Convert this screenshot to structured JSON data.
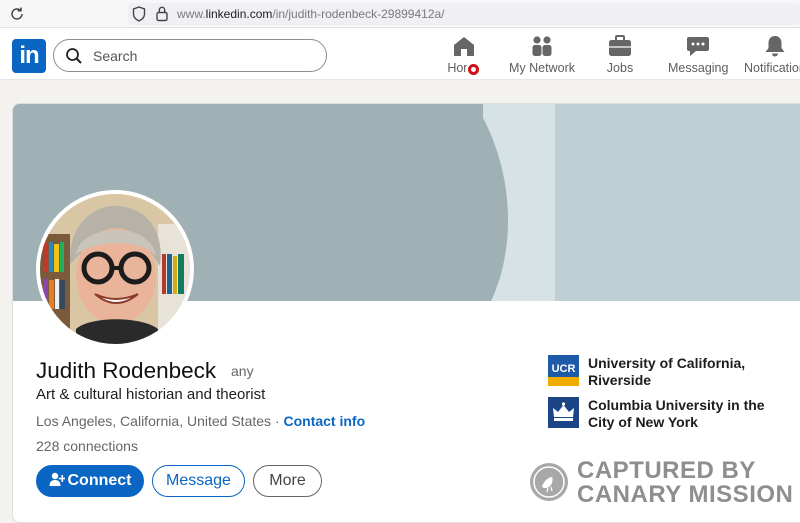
{
  "browser": {
    "url_prefix": "www.",
    "url_host": "linkedin.com",
    "url_path": "/in/judith-rodenbeck-29899412a/"
  },
  "nav": {
    "logo_text": "in",
    "search_placeholder": "Search",
    "items": [
      {
        "label": "Home",
        "icon": "home-icon"
      },
      {
        "label": "My Network",
        "icon": "network-icon"
      },
      {
        "label": "Jobs",
        "icon": "briefcase-icon"
      },
      {
        "label": "Messaging",
        "icon": "chat-icon"
      },
      {
        "label": "Notifications",
        "icon": "bell-icon"
      }
    ],
    "brand_color": "#0a66c2",
    "notification_color": "#cc1016"
  },
  "profile": {
    "name": "Judith Rodenbeck",
    "pronoun": "any",
    "headline": "Art & cultural historian and theorist",
    "location": "Los Angeles, California, United States",
    "separator": " · ",
    "contact_info": "Contact info",
    "connections": "228 connections",
    "banner_color": "#9fb1b5"
  },
  "actions": {
    "connect": "Connect",
    "message": "Message",
    "more": "More"
  },
  "education": [
    {
      "name": "University of California, Riverside",
      "logo": "UCR",
      "logo_color": "#1d5aa8"
    },
    {
      "name": "Columbia University in the City of New York",
      "logo": "crown-icon",
      "logo_color": "#1c4587"
    }
  ],
  "watermark": {
    "line1": "CAPTURED BY",
    "line2": "CANARY MISSION"
  }
}
